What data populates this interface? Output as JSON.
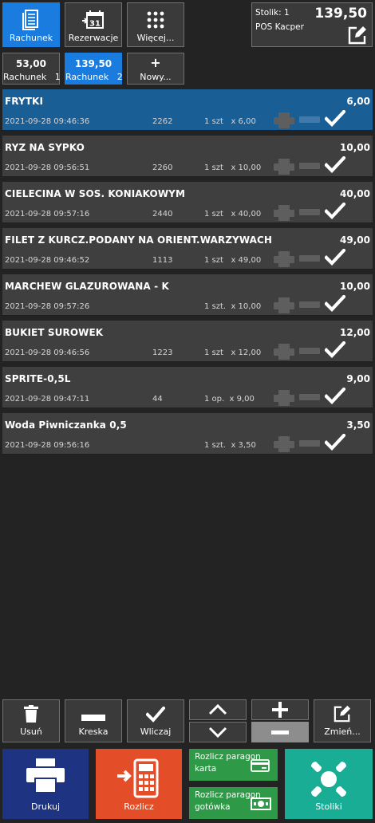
{
  "toolbar": {
    "rachunek": "Rachunek",
    "rezerwacje": "Rezerwacje",
    "wiecej": "Więcej...",
    "calendar_day": "31"
  },
  "table_info": {
    "label": "Stolik: 1",
    "total": "139,50",
    "pos": "POS Kacper"
  },
  "bills": [
    {
      "total": "53,00",
      "label": "Rachunek   1"
    },
    {
      "total": "139,50",
      "label": "Rachunek   2"
    },
    {
      "total": "+",
      "label": "Nowy..."
    }
  ],
  "items": [
    {
      "name": "FRYTKI",
      "price": "6,00",
      "date": "2021-09-28 09:46:36",
      "code": "2262",
      "qty": "1 szt   x 6,00"
    },
    {
      "name": "RYZ NA SYPKO",
      "price": "10,00",
      "date": "2021-09-28 09:56:51",
      "code": "2260",
      "qty": "1 szt   x 10,00"
    },
    {
      "name": "CIELECINA W SOS. KONIAKOWYM",
      "price": "40,00",
      "date": "2021-09-28 09:57:16",
      "code": "2440",
      "qty": "1 szt   x 40,00"
    },
    {
      "name": "FILET Z KURCZ.PODANY NA ORIENT.WARZYWACH",
      "price": "49,00",
      "date": "2021-09-28 09:46:52",
      "code": "1113",
      "qty": "1 szt   x 49,00"
    },
    {
      "name": "MARCHEW GLAZUROWANA - K",
      "price": "10,00",
      "date": "2021-09-28 09:57:26",
      "code": "",
      "qty": "1 szt.  x 10,00"
    },
    {
      "name": "BUKIET SUROWEK",
      "price": "12,00",
      "date": "2021-09-28 09:46:56",
      "code": "1223",
      "qty": "1 szt   x 12,00"
    },
    {
      "name": "SPRITE-0,5L",
      "price": "9,00",
      "date": "2021-09-28 09:47:11",
      "code": "44",
      "qty": "1 op.  x 9,00"
    },
    {
      "name": "Woda Piwniczanka 0,5",
      "price": "3,50",
      "date": "2021-09-28 09:56:16",
      "code": "",
      "qty": "1 szt.  x 3,50"
    }
  ],
  "actions": {
    "usun": "Usuń",
    "kreska": "Kreska",
    "wliczaj": "Wliczaj",
    "zmien": "Zmień..."
  },
  "bottom": {
    "drukuj": "Drukuj",
    "rozlicz": "Rozlicz",
    "paragon_karta_1": "Rozlicz paragon",
    "paragon_karta_2": "karta",
    "paragon_gotowka_1": "Rozlicz paragon",
    "paragon_gotowka_2": "gotówka",
    "stoliki": "Stoliki"
  },
  "colors": {
    "accent": "#1b7ce0",
    "selected_row": "#1a5e96",
    "print_button": "#1e3382",
    "settle_button": "#e34e29",
    "paragon_green": "#2e9a48",
    "tables_teal": "#19ad96"
  },
  "icons": {
    "rachunek": "document-icon",
    "rezerwacje": "calendar-icon",
    "wiecej": "grid-dots-icon",
    "edit": "edit-icon",
    "row_print": "printer-icon",
    "row_check": "check-icon",
    "usun": "trash-icon",
    "kreska": "minus-bar-icon",
    "wliczaj": "check-icon",
    "drukuj": "printer-icon",
    "rozlicz": "calculator-icon",
    "card": "card-icon",
    "cash": "cash-icon",
    "stoliki": "tables-icon"
  }
}
